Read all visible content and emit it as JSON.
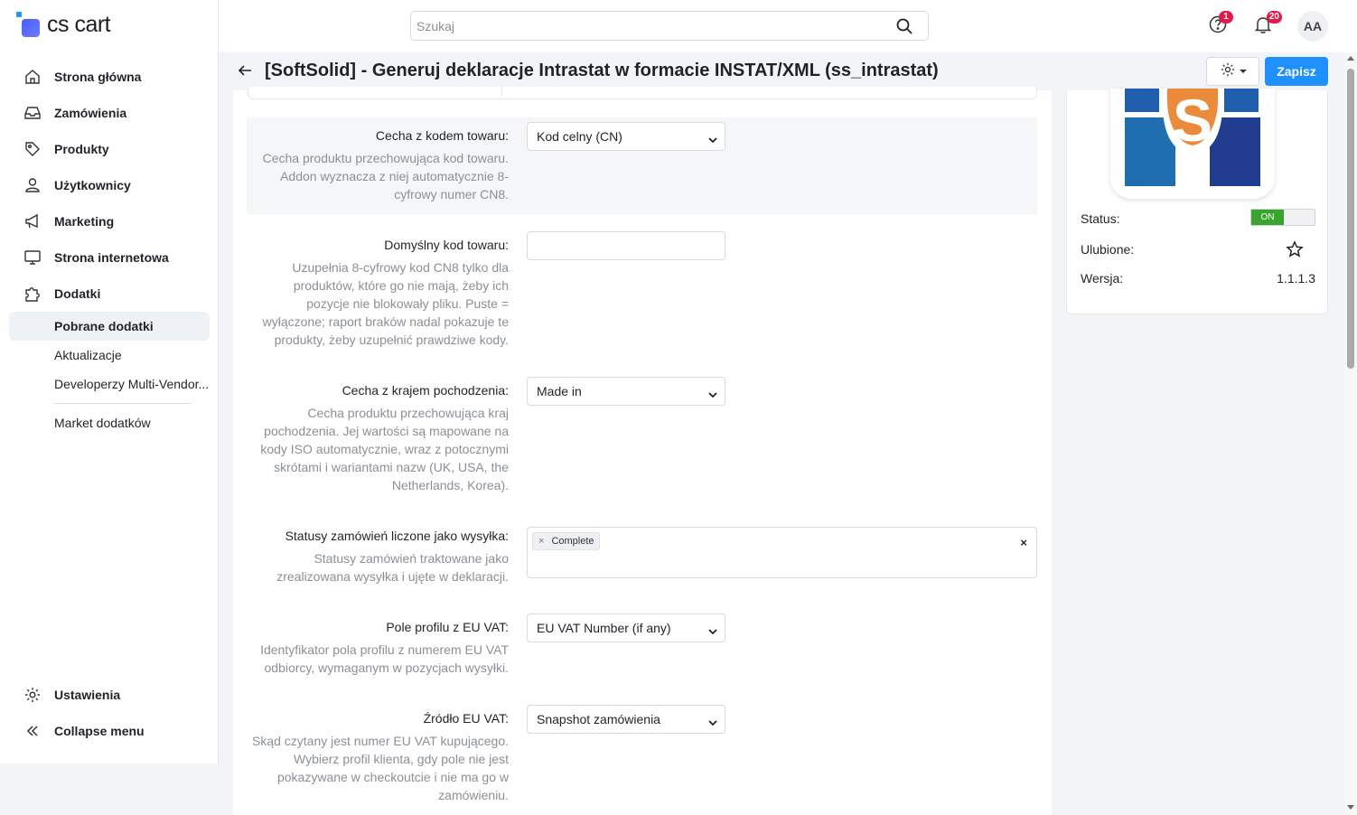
{
  "brand": {
    "name": "cs cart"
  },
  "sidebar": {
    "items": [
      {
        "label": "Strona główna",
        "icon": "home-icon"
      },
      {
        "label": "Zamówienia",
        "icon": "inbox-icon"
      },
      {
        "label": "Produkty",
        "icon": "tag-icon"
      },
      {
        "label": "Użytkownicy",
        "icon": "user-icon"
      },
      {
        "label": "Marketing",
        "icon": "megaphone-icon"
      },
      {
        "label": "Strona internetowa",
        "icon": "monitor-icon"
      },
      {
        "label": "Dodatki",
        "icon": "puzzle-icon"
      }
    ],
    "sub_items": [
      "Pobrane dodatki",
      "Aktualizacje",
      "Developerzy Multi-Vendor...",
      "Market dodatków"
    ],
    "bottom": [
      {
        "label": "Ustawienia",
        "icon": "gear-icon"
      },
      {
        "label": "Collapse menu",
        "icon": "collapse-icon"
      }
    ]
  },
  "topbar": {
    "search_placeholder": "Szukaj",
    "help_badge": "1",
    "notifications_badge": "20",
    "avatar": "AA"
  },
  "page": {
    "title": "[SoftSolid] - Generuj deklaracje Intrastat w formacie INSTAT/XML (ss_intrastat)",
    "save_label": "Zapisz"
  },
  "fields": [
    {
      "label": "Cecha z kodem towaru:",
      "help": "Cecha produktu przechowująca kod towaru. Addon wyznacza z niej automatycznie 8-cyfrowy numer CN8.",
      "value": "Kod celny (CN)"
    },
    {
      "label": "Domyślny kod towaru:",
      "help": "Uzupełnia 8-cyfrowy kod CN8 tylko dla produktów, które go nie mają, żeby ich pozycje nie blokowały pliku. Puste = wyłączone; raport braków nadal pokazuje te produkty, żeby uzupełnić prawdziwe kody.",
      "value": ""
    },
    {
      "label": "Cecha z krajem pochodzenia:",
      "help": "Cecha produktu przechowująca kraj pochodzenia. Jej wartości są mapowane na kody ISO automatycznie, wraz z potocznymi skrótami i wariantami nazw (UK, USA, the Netherlands, Korea).",
      "value": "Made in"
    },
    {
      "label": "Statusy zamówień liczone jako wysyłka:",
      "help": "Statusy zamówień traktowane jako zrealizowana wysyłka i ujęte w deklaracji.",
      "chips": [
        "Complete"
      ]
    },
    {
      "label": "Pole profilu z EU VAT:",
      "help": "Identyfikator pola profilu z numerem EU VAT odbiorcy, wymaganym w pozycjach wysyłki.",
      "value": "EU VAT Number (if any)"
    },
    {
      "label": "Źródło EU VAT:",
      "help": "Skąd czytany jest numer EU VAT kupującego. Wybierz profil klienta, gdy pole nie jest pokazywane w checkoutcie i nie ma go w zamówieniu.",
      "value": "Snapshot zamówienia"
    }
  ],
  "addon_panel": {
    "status_label": "Status:",
    "status_value": "ON",
    "favorite_label": "Ulubione:",
    "version_label": "Wersja:",
    "version_value": "1.1.1.3"
  },
  "colors": {
    "accent": "#1e90ff",
    "toggle_on": "#3aa52e",
    "badge": "#e01b4c"
  }
}
